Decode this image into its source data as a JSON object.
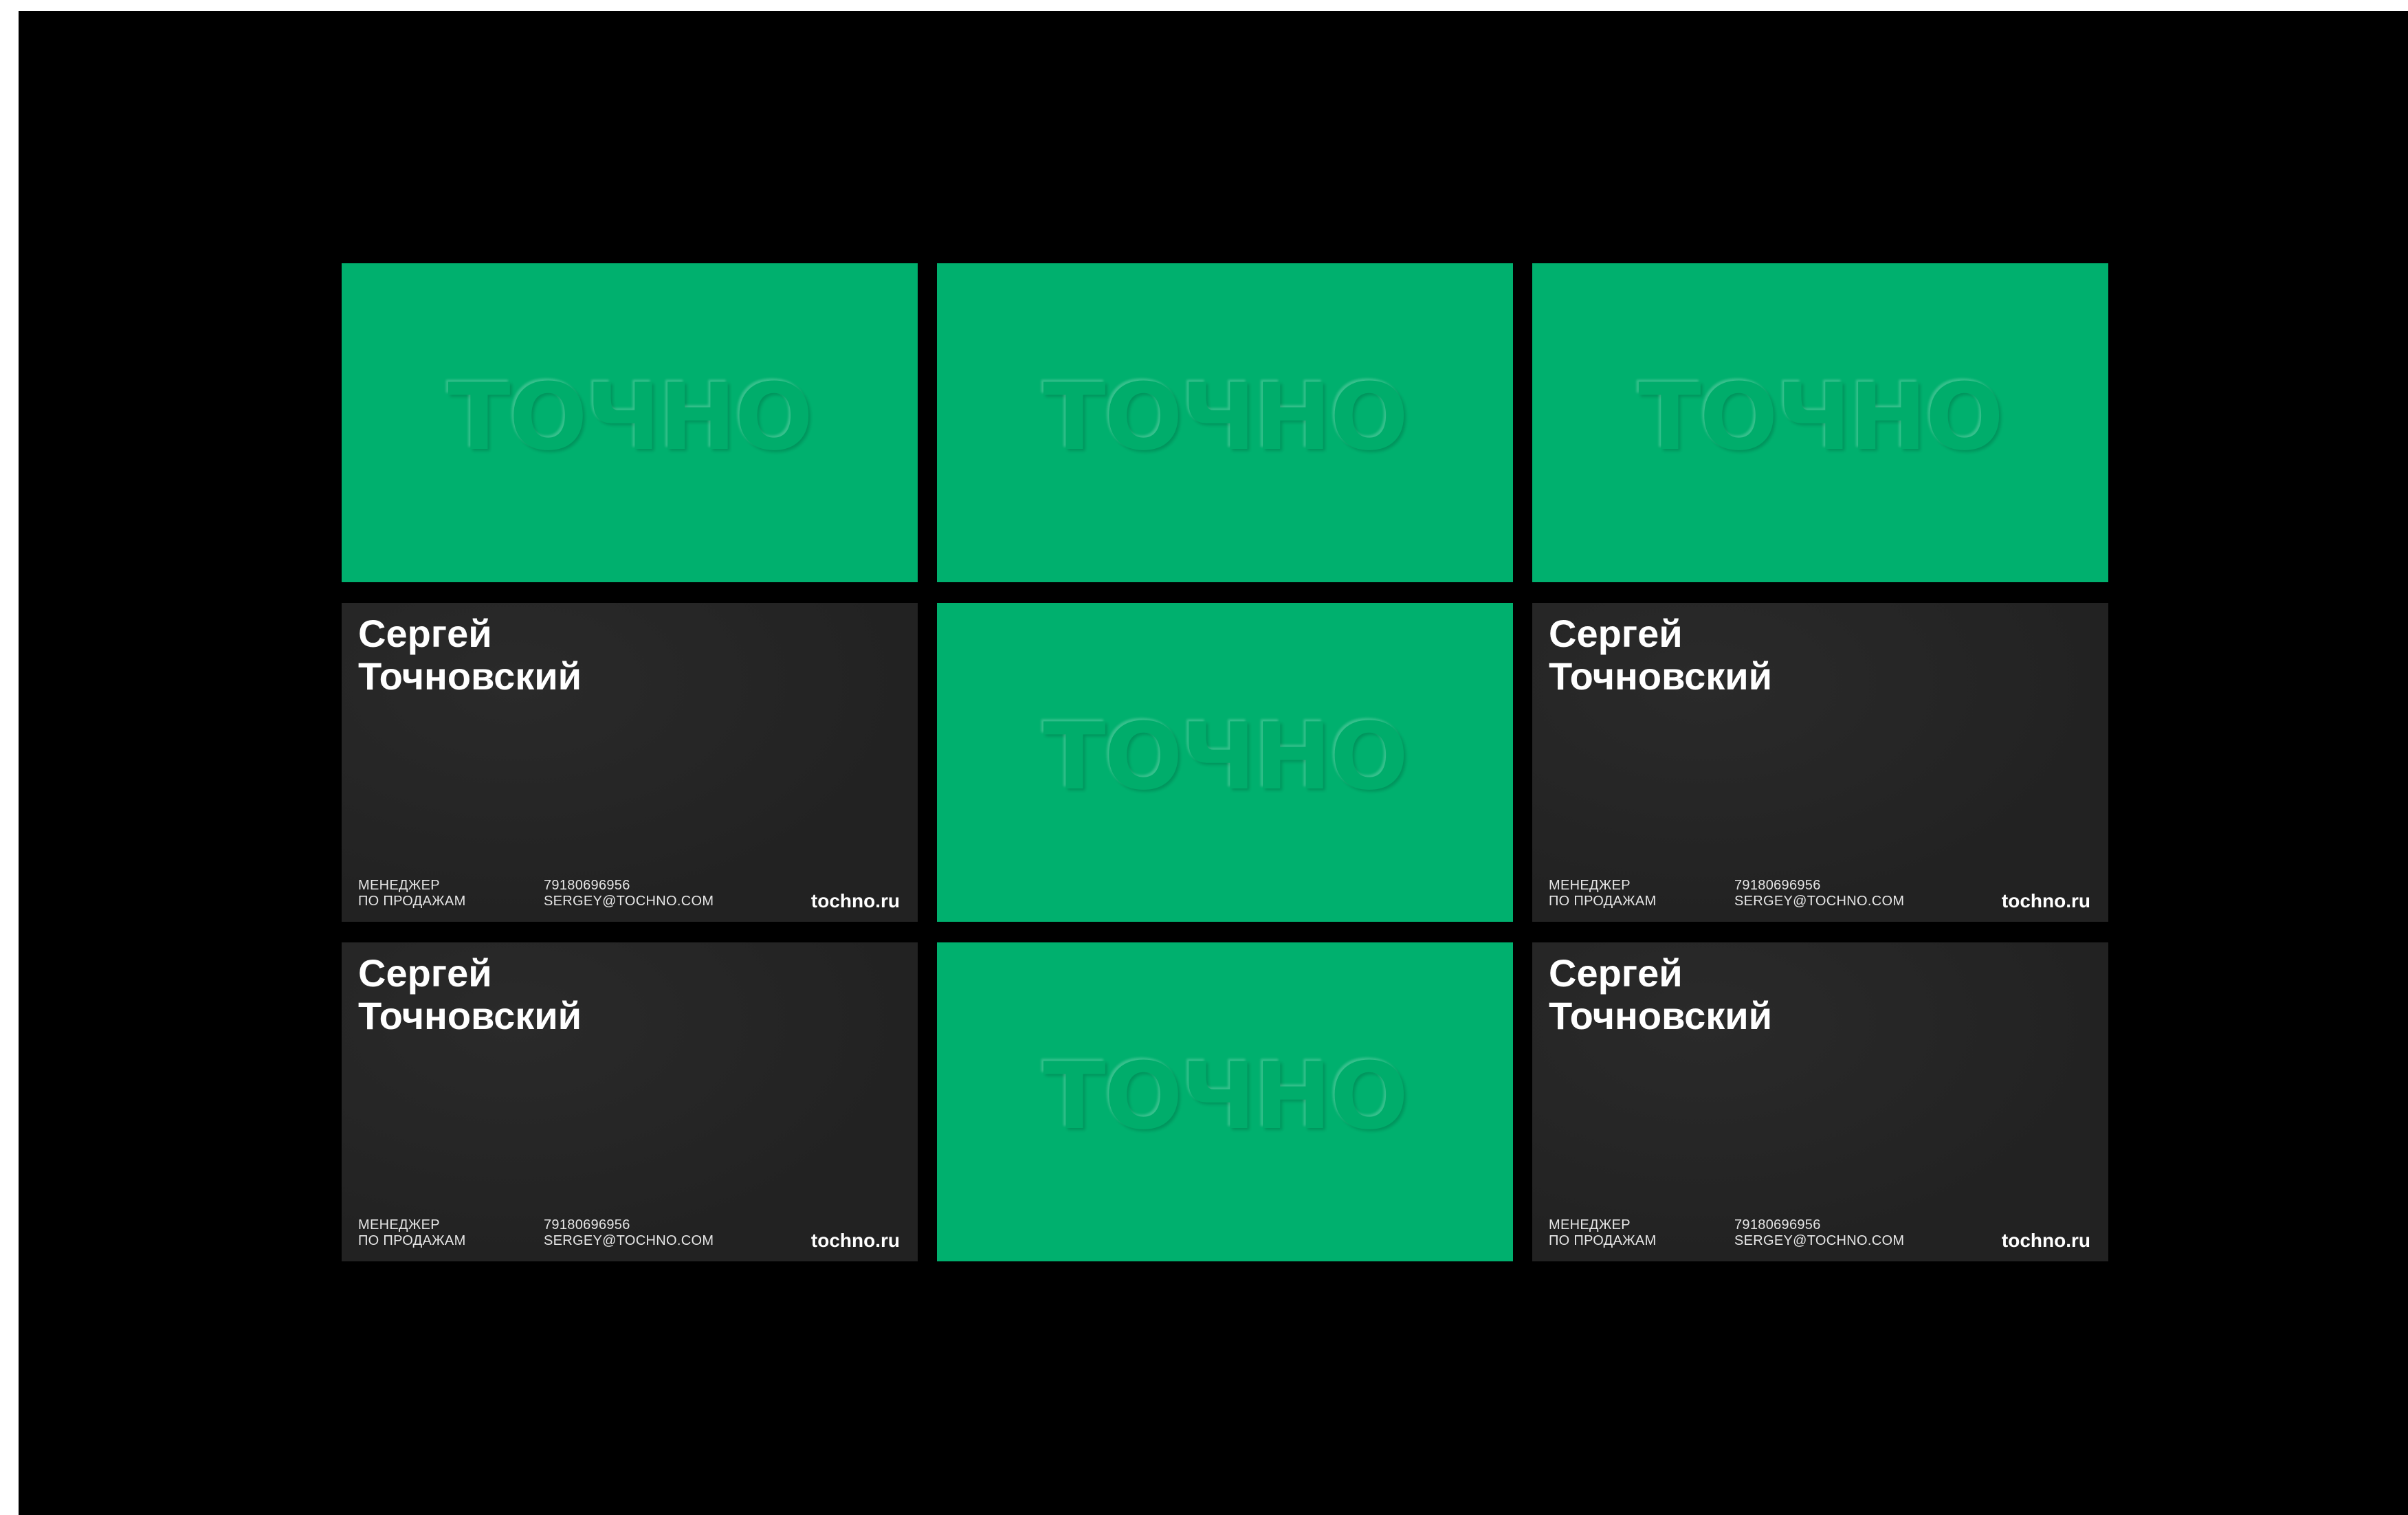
{
  "logo_text": "ТОЧНО",
  "colors": {
    "background": "#000000",
    "brand_green": "#00b06e",
    "card_dark": "#232323",
    "text_light": "#ffffff"
  },
  "card": {
    "name_first": "Сергей",
    "name_last": "Точновский",
    "role_line1": "МЕНЕДЖЕР",
    "role_line2": "ПО ПРОДАЖАМ",
    "phone": "79180696956",
    "email": "SERGEY@TOCHNO.COM",
    "website": "tochno.ru"
  },
  "layout_cards": [
    {
      "position": "row1-col1",
      "side": "front"
    },
    {
      "position": "row1-col2",
      "side": "front"
    },
    {
      "position": "row1-col3",
      "side": "front"
    },
    {
      "position": "row2-col1",
      "side": "back"
    },
    {
      "position": "row2-col2",
      "side": "front"
    },
    {
      "position": "row2-col3",
      "side": "back"
    },
    {
      "position": "row3-col1",
      "side": "back"
    },
    {
      "position": "row3-col2",
      "side": "front"
    },
    {
      "position": "row3-col3",
      "side": "back"
    }
  ]
}
